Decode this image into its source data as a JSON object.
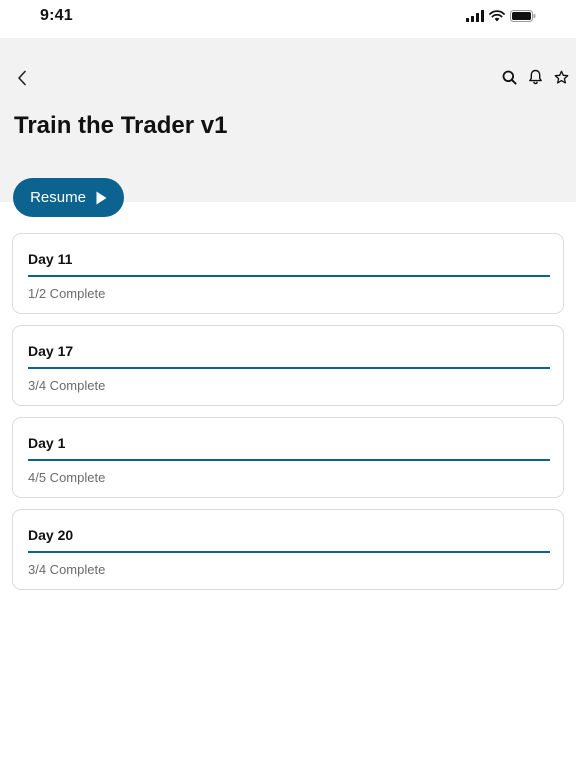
{
  "status_bar": {
    "time": "9:41"
  },
  "header": {
    "title": "Train the Trader v1",
    "icons": [
      "back-chevron-icon",
      "search-icon",
      "bell-icon",
      "star-icon"
    ]
  },
  "resume_button": {
    "label": "Resume",
    "icon": "play-icon"
  },
  "modules": [
    {
      "title": "Day 11",
      "status": "1/2 Complete",
      "progress": 1.0
    },
    {
      "title": "Day 17",
      "status": "3/4 Complete",
      "progress": 1.0
    },
    {
      "title": "Day 1",
      "status": "4/5 Complete",
      "progress": 1.0
    },
    {
      "title": "Day 20",
      "status": "3/4 Complete",
      "progress": 1.0
    }
  ],
  "colors": {
    "accent": "#0c6390",
    "header_bg": "#f2f2f2",
    "card_border": "#dcdcdc"
  }
}
